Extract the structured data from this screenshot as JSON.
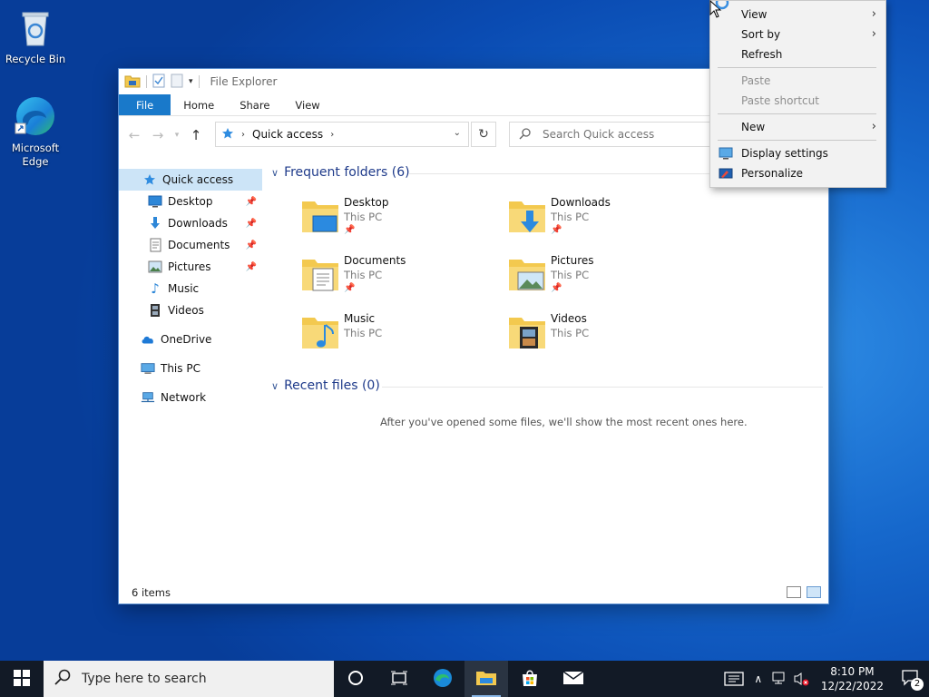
{
  "desktop": {
    "icons": [
      {
        "label": "Recycle Bin",
        "icon": "recycle-bin-icon"
      },
      {
        "label": "Microsoft Edge",
        "icon": "edge-icon"
      }
    ]
  },
  "explorer": {
    "title": "File Explorer",
    "tabs": [
      "File",
      "Home",
      "Share",
      "View"
    ],
    "address": {
      "location": "Quick access"
    },
    "search": {
      "placeholder": "Search Quick access"
    },
    "nav": [
      {
        "label": "Quick access",
        "icon": "star-icon",
        "selected": true
      },
      {
        "label": "Desktop",
        "icon": "desktop-icon",
        "pinned": true
      },
      {
        "label": "Downloads",
        "icon": "download-icon",
        "pinned": true
      },
      {
        "label": "Documents",
        "icon": "document-icon",
        "pinned": true
      },
      {
        "label": "Pictures",
        "icon": "picture-icon",
        "pinned": true
      },
      {
        "label": "Music",
        "icon": "music-icon"
      },
      {
        "label": "Videos",
        "icon": "video-icon"
      },
      {
        "label": "OneDrive",
        "icon": "cloud-icon"
      },
      {
        "label": "This PC",
        "icon": "computer-icon"
      },
      {
        "label": "Network",
        "icon": "network-icon"
      }
    ],
    "frequent": {
      "heading": "Frequent folders (6)",
      "folders": [
        {
          "name": "Desktop",
          "location": "This PC",
          "pinned": true
        },
        {
          "name": "Downloads",
          "location": "This PC",
          "pinned": true
        },
        {
          "name": "Documents",
          "location": "This PC",
          "pinned": true
        },
        {
          "name": "Pictures",
          "location": "This PC",
          "pinned": true
        },
        {
          "name": "Music",
          "location": "This PC",
          "pinned": false
        },
        {
          "name": "Videos",
          "location": "This PC",
          "pinned": false
        }
      ]
    },
    "recent": {
      "heading": "Recent files (0)",
      "empty_message": "After you've opened some files, we'll show the most recent ones here."
    },
    "status": {
      "items": "6 items"
    }
  },
  "context_menu": {
    "items": [
      {
        "label": "View",
        "submenu": true
      },
      {
        "label": "Sort by",
        "submenu": true
      },
      {
        "label": "Refresh"
      },
      {
        "label": "Paste",
        "disabled": true
      },
      {
        "label": "Paste shortcut",
        "disabled": true
      },
      {
        "label": "New",
        "submenu": true
      },
      {
        "label": "Display settings",
        "icon": "display-icon"
      },
      {
        "label": "Personalize",
        "icon": "personalize-icon"
      }
    ]
  },
  "taskbar": {
    "search_placeholder": "Type here to search",
    "time": "8:10 PM",
    "date": "12/22/2022",
    "notification_count": "2"
  },
  "colors": {
    "accent": "#1979ca",
    "folder": "#f3c94f",
    "taskbar": "#121a26"
  }
}
